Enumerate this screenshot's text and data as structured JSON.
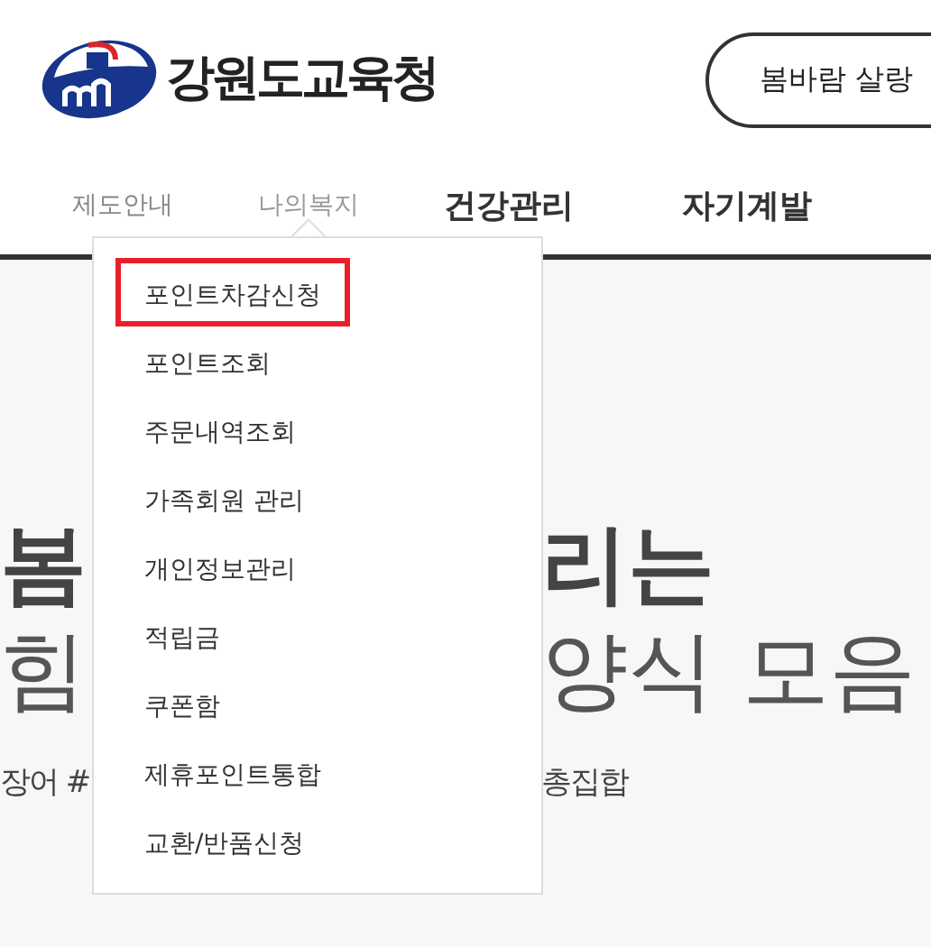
{
  "header": {
    "logo_text": "강원도교육청",
    "search": {
      "value": "봄바람 살랑"
    }
  },
  "nav": [
    {
      "label": "제도안내",
      "emphasized": false,
      "expanded": false
    },
    {
      "label": "나의복지",
      "emphasized": false,
      "expanded": true
    },
    {
      "label": "건강관리",
      "emphasized": true,
      "expanded": false
    },
    {
      "label": "자기계발",
      "emphasized": true,
      "expanded": false
    }
  ],
  "dropdown": [
    {
      "label": "포인트차감신청",
      "selected": true
    },
    {
      "label": "포인트조회",
      "selected": false
    },
    {
      "label": "주문내역조회",
      "selected": false
    },
    {
      "label": "가족회원 관리",
      "selected": false
    },
    {
      "label": "개인정보관리",
      "selected": false
    },
    {
      "label": "적립금",
      "selected": false
    },
    {
      "label": "쿠폰함",
      "selected": false
    },
    {
      "label": "제휴포인트통합",
      "selected": false
    },
    {
      "label": "교환/반품신청",
      "selected": false
    }
  ],
  "hero": [
    {
      "kind": "title",
      "left": "봄",
      "right": "리는"
    },
    {
      "kind": "subtitle",
      "left": "힘",
      "right": "양식 모음"
    },
    {
      "kind": "tags",
      "left": "장어 #",
      "right": "총집합"
    }
  ]
}
